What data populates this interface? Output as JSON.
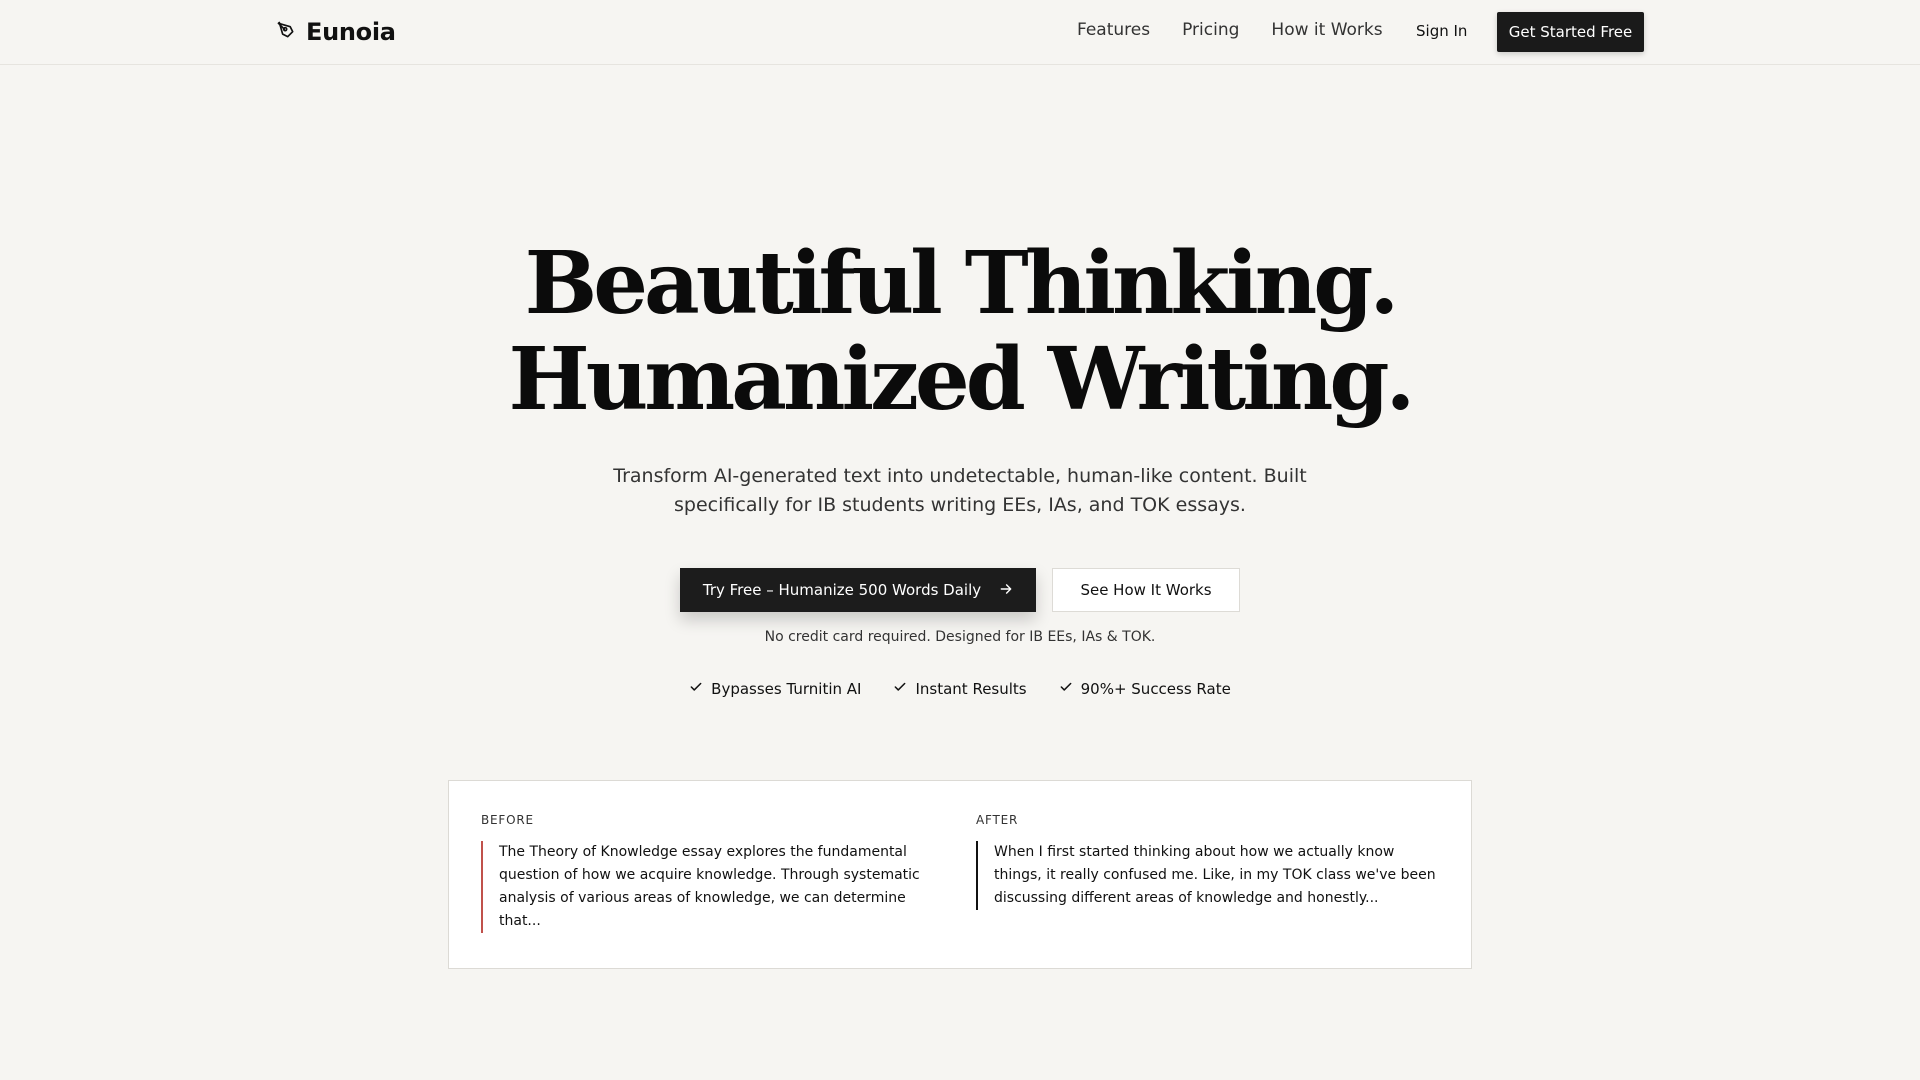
{
  "nav": {
    "logo_text": "Eunoia",
    "links": [
      "Features",
      "Pricing",
      "How it Works"
    ],
    "signin": "Sign In",
    "cta": "Get Started Free"
  },
  "hero": {
    "title_line1": "Beautiful Thinking.",
    "title_line2": "Humanized Writing.",
    "subtitle": "Transform AI-generated text into undetectable, human-like content. Built specifically for IB students writing EEs, IAs, and TOK essays.",
    "primary_cta": "Try Free – Humanize 500 Words Daily",
    "secondary_cta": "See How It Works",
    "note": "No credit card required. Designed for IB EEs, IAs & TOK.",
    "checks": [
      "Bypasses Turnitin AI",
      "Instant Results",
      "90%+ Success Rate"
    ]
  },
  "compare": {
    "before_label": "BEFORE",
    "before_text": "The Theory of Knowledge essay explores the fundamental question of how we acquire knowledge. Through systematic analysis of various areas of knowledge, we can determine that...",
    "after_label": "AFTER",
    "after_text": "When I first started thinking about how we actually know things, it really confused me. Like, in my TOK class we've been discussing different areas of knowledge and honestly..."
  },
  "colors": {
    "background": "#f6f5f2",
    "primary_button": "#1c1c1c",
    "before_accent": "#c0514b",
    "after_accent": "#111111"
  },
  "icons": {
    "logo": "pen-nib-icon",
    "arrow": "arrow-right-icon",
    "check": "check-icon"
  }
}
